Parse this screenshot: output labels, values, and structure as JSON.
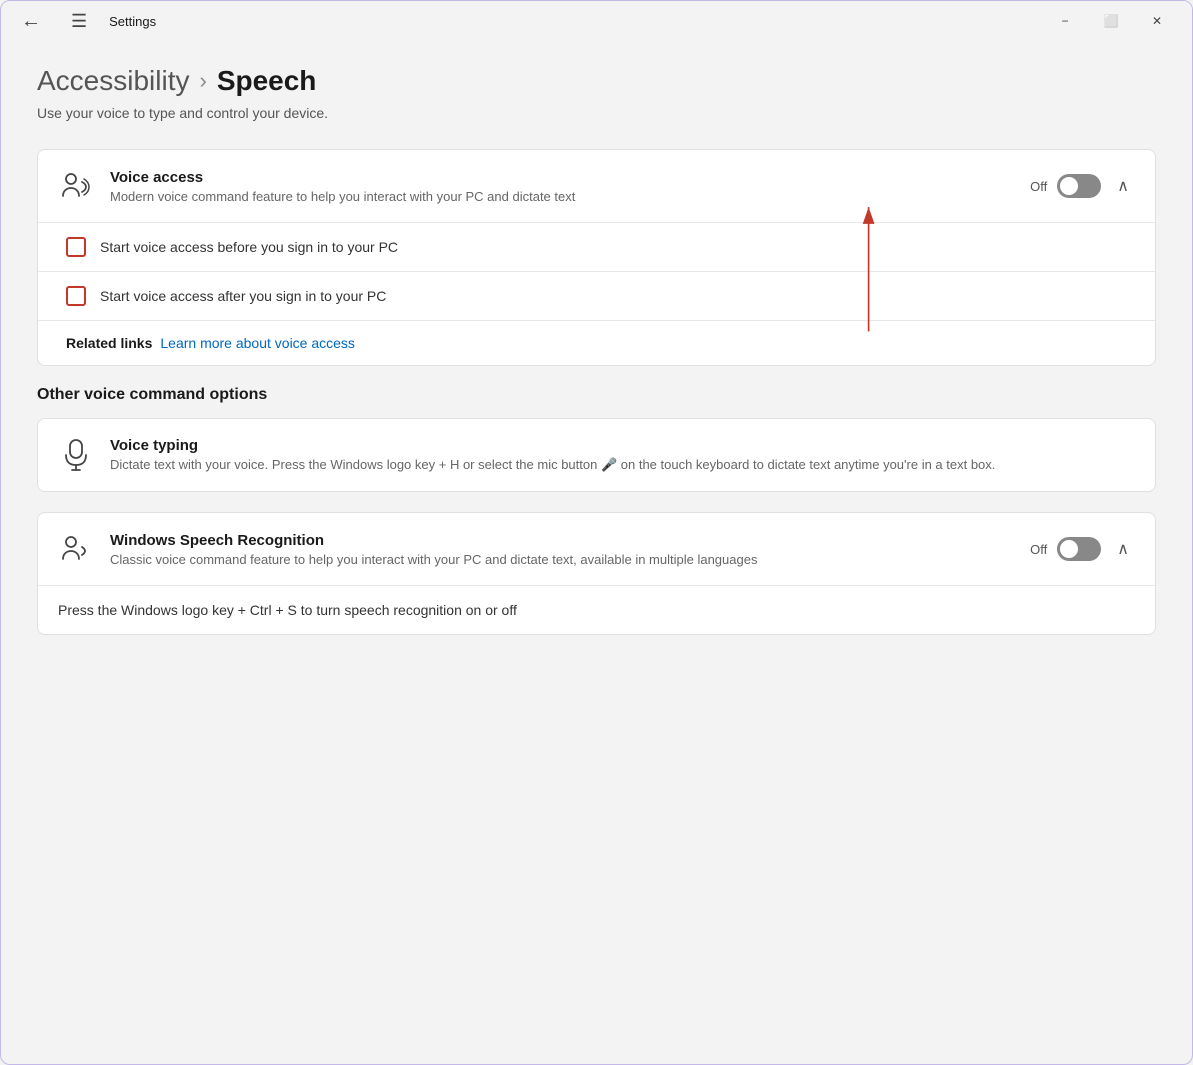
{
  "window": {
    "title": "Settings",
    "minimize_label": "−",
    "restore_label": "⬜",
    "close_label": "✕"
  },
  "breadcrumb": {
    "parent": "Accessibility",
    "separator": "›",
    "current": "Speech"
  },
  "page_description": "Use your voice to type and control your device.",
  "voice_access": {
    "title": "Voice access",
    "subtitle": "Modern voice command feature to help you interact with your PC and dictate text",
    "toggle_label": "Off",
    "toggle_state": "off",
    "checkbox1_label": "Start voice access before you sign in to your PC",
    "checkbox2_label": "Start voice access after you sign in to your PC",
    "related_links_label": "Related links",
    "related_links_link": "Learn more about voice access"
  },
  "other_section": {
    "heading": "Other voice command options"
  },
  "voice_typing": {
    "title": "Voice typing",
    "subtitle": "Dictate text with your voice. Press the Windows logo key  + H or select the mic button 🎤 on the touch keyboard to dictate text anytime you're in a text box."
  },
  "windows_speech": {
    "title": "Windows Speech Recognition",
    "subtitle": "Classic voice command feature to help you interact with your PC and dictate text, available in multiple languages",
    "toggle_label": "Off",
    "toggle_state": "off",
    "shortcut_text": "Press the Windows logo key  + Ctrl + S to turn speech recognition on or off"
  }
}
